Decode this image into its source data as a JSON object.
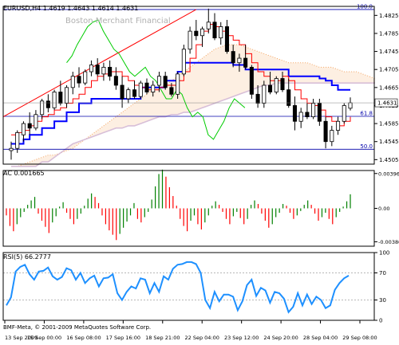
{
  "chart_data": [
    {
      "type": "candlestick",
      "title": "EURUSD,H4  1.4619 1.4643 1.4614 1.4631",
      "watermark": "Boston Merchant Financial",
      "yticks": [
        "1.4825",
        "1.4785",
        "1.4745",
        "1.4705",
        "1.4665",
        "1.4625",
        "1.4585",
        "1.4545",
        "1.4505"
      ],
      "ylim": [
        1.4495,
        1.4845
      ],
      "price_label": "1.4631",
      "fib_levels": [
        {
          "label": "100.0",
          "value": 1.4838
        },
        {
          "label": "61.8",
          "value": 1.4601
        },
        {
          "label": "50.0",
          "value": 1.4528
        }
      ],
      "colors": {
        "bull": "#008000",
        "bear": "#000000",
        "tenkan": "#ff0000",
        "kijun": "#0000ff",
        "senkou_a": "#f4a460",
        "senkou_b": "#d8bfd8",
        "chikou": "#00cc00",
        "trendline": "#ff0000"
      },
      "candles": [
        [
          1.4525,
          1.4545,
          1.4505,
          1.453
        ],
        [
          1.453,
          1.457,
          1.452,
          1.4565
        ],
        [
          1.456,
          1.459,
          1.4545,
          1.4585
        ],
        [
          1.4585,
          1.461,
          1.456,
          1.4575
        ],
        [
          1.4575,
          1.4615,
          1.457,
          1.4605
        ],
        [
          1.4605,
          1.464,
          1.4595,
          1.4635
        ],
        [
          1.4635,
          1.465,
          1.461,
          1.462
        ],
        [
          1.462,
          1.466,
          1.4615,
          1.4655
        ],
        [
          1.4655,
          1.468,
          1.4625,
          1.463
        ],
        [
          1.463,
          1.467,
          1.462,
          1.4665
        ],
        [
          1.4665,
          1.47,
          1.465,
          1.469
        ],
        [
          1.469,
          1.471,
          1.4665,
          1.4675
        ],
        [
          1.4675,
          1.4705,
          1.467,
          1.47
        ],
        [
          1.47,
          1.4725,
          1.469,
          1.4715
        ],
        [
          1.4715,
          1.473,
          1.469,
          1.4695
        ],
        [
          1.4695,
          1.472,
          1.468,
          1.471
        ],
        [
          1.471,
          1.4725,
          1.468,
          1.469
        ],
        [
          1.469,
          1.471,
          1.466,
          1.467
        ],
        [
          1.467,
          1.469,
          1.462,
          1.464
        ],
        [
          1.464,
          1.4665,
          1.463,
          1.466
        ],
        [
          1.466,
          1.468,
          1.464,
          1.4645
        ],
        [
          1.4645,
          1.468,
          1.464,
          1.4675
        ],
        [
          1.4675,
          1.4685,
          1.465,
          1.4655
        ],
        [
          1.4655,
          1.468,
          1.4645,
          1.467
        ],
        [
          1.467,
          1.47,
          1.4655,
          1.469
        ],
        [
          1.469,
          1.47,
          1.466,
          1.4665
        ],
        [
          1.4665,
          1.4675,
          1.4645,
          1.465
        ],
        [
          1.465,
          1.47,
          1.464,
          1.4695
        ],
        [
          1.4695,
          1.476,
          1.469,
          1.475
        ],
        [
          1.475,
          1.48,
          1.474,
          1.479
        ],
        [
          1.479,
          1.4815,
          1.477,
          1.478
        ],
        [
          1.478,
          1.48,
          1.4755,
          1.4795
        ],
        [
          1.4795,
          1.484,
          1.4785,
          1.481
        ],
        [
          1.481,
          1.483,
          1.477,
          1.4775
        ],
        [
          1.4775,
          1.481,
          1.476,
          1.48
        ],
        [
          1.48,
          1.4815,
          1.474,
          1.4745
        ],
        [
          1.4745,
          1.476,
          1.471,
          1.472
        ],
        [
          1.472,
          1.474,
          1.47,
          1.473
        ],
        [
          1.473,
          1.476,
          1.4705,
          1.471
        ],
        [
          1.471,
          1.4715,
          1.464,
          1.465
        ],
        [
          1.465,
          1.467,
          1.462,
          1.463
        ],
        [
          1.463,
          1.468,
          1.462,
          1.467
        ],
        [
          1.467,
          1.47,
          1.465,
          1.4655
        ],
        [
          1.4655,
          1.469,
          1.465,
          1.4685
        ],
        [
          1.4685,
          1.47,
          1.4655,
          1.466
        ],
        [
          1.466,
          1.4685,
          1.462,
          1.4625
        ],
        [
          1.4625,
          1.4645,
          1.457,
          1.459
        ],
        [
          1.459,
          1.462,
          1.4575,
          1.461
        ],
        [
          1.461,
          1.463,
          1.4595,
          1.46
        ],
        [
          1.46,
          1.464,
          1.4595,
          1.463
        ],
        [
          1.463,
          1.464,
          1.458,
          1.459
        ],
        [
          1.459,
          1.46,
          1.453,
          1.4545
        ],
        [
          1.4545,
          1.458,
          1.4535,
          1.457
        ],
        [
          1.457,
          1.46,
          1.456,
          1.459
        ],
        [
          1.459,
          1.463,
          1.4585,
          1.4625
        ],
        [
          1.4619,
          1.4643,
          1.4614,
          1.4631
        ]
      ],
      "tenkan": [
        1.456,
        1.4565,
        1.457,
        1.458,
        1.459,
        1.46,
        1.4605,
        1.4615,
        1.462,
        1.463,
        1.464,
        1.465,
        1.4665,
        1.468,
        1.469,
        1.4695,
        1.47,
        1.47,
        1.469,
        1.468,
        1.467,
        1.4665,
        1.466,
        1.466,
        1.4665,
        1.467,
        1.467,
        1.468,
        1.47,
        1.473,
        1.476,
        1.479,
        1.4805,
        1.48,
        1.479,
        1.478,
        1.477,
        1.476,
        1.474,
        1.472,
        1.47,
        1.469,
        1.468,
        1.468,
        1.469,
        1.468,
        1.466,
        1.464,
        1.463,
        1.4625,
        1.4615,
        1.46,
        1.459,
        1.458,
        1.459,
        1.46
      ],
      "kijun": [
        1.454,
        1.454,
        1.455,
        1.456,
        1.456,
        1.4575,
        1.4575,
        1.459,
        1.459,
        1.461,
        1.461,
        1.463,
        1.463,
        1.464,
        1.464,
        1.464,
        1.464,
        1.464,
        1.464,
        1.464,
        1.464,
        1.4665,
        1.4665,
        1.4665,
        1.4665,
        1.468,
        1.468,
        1.47,
        1.472,
        1.472,
        1.472,
        1.472,
        1.472,
        1.472,
        1.472,
        1.472,
        1.4715,
        1.4715,
        1.4705,
        1.4705,
        1.4705,
        1.4705,
        1.4705,
        1.4705,
        1.4705,
        1.469,
        1.469,
        1.469,
        1.469,
        1.469,
        1.4685,
        1.468,
        1.467,
        1.466,
        1.466,
        1.466
      ],
      "senkou_a": [
        1.449,
        1.449,
        1.4495,
        1.45,
        1.4505,
        1.451,
        1.4515,
        1.4515,
        1.452,
        1.4525,
        1.453,
        1.454,
        1.455,
        1.456,
        1.457,
        1.458,
        1.459,
        1.46,
        1.461,
        1.462,
        1.463,
        1.464,
        1.465,
        1.466,
        1.4665,
        1.467,
        1.468,
        1.469,
        1.47,
        1.471,
        1.472,
        1.473,
        1.474,
        1.475,
        1.4755,
        1.476,
        1.476,
        1.476,
        1.4755,
        1.475,
        1.4745,
        1.474,
        1.4735,
        1.473,
        1.4725,
        1.472,
        1.472,
        1.472,
        1.472,
        1.4715,
        1.471,
        1.471,
        1.471,
        1.4705,
        1.47,
        1.47,
        1.47,
        1.4695,
        1.469,
        1.4685
      ],
      "senkou_b": [
        1.449,
        1.449,
        1.449,
        1.449,
        1.449,
        1.45,
        1.45,
        1.451,
        1.452,
        1.453,
        1.454,
        1.4545,
        1.455,
        1.4555,
        1.456,
        1.4565,
        1.457,
        1.4575,
        1.4575,
        1.458,
        1.458,
        1.4585,
        1.459,
        1.4595,
        1.46,
        1.46,
        1.4605,
        1.4605,
        1.461,
        1.461,
        1.4615,
        1.462,
        1.4625,
        1.463,
        1.4635,
        1.464,
        1.4645,
        1.465,
        1.4655,
        1.466,
        1.4665,
        1.467,
        1.467,
        1.4675,
        1.4675,
        1.4675,
        1.4675,
        1.4675,
        1.4675,
        1.4675,
        1.4675,
        1.4675,
        1.4675,
        1.4675,
        1.4675,
        1.4675,
        1.4675,
        1.4675,
        1.4675,
        1.4675
      ],
      "chikou": [
        1.472,
        1.4735,
        1.476,
        1.478,
        1.48,
        1.481,
        1.4815,
        1.479,
        1.477,
        1.475,
        1.474,
        1.472,
        1.47,
        1.469,
        1.47,
        1.471,
        1.469,
        1.468,
        1.466,
        1.464,
        1.464,
        1.466,
        1.465,
        1.462,
        1.46,
        1.461,
        1.46,
        1.456,
        1.455,
        1.457,
        1.459,
        1.462,
        1.464,
        1.463,
        1.462
      ]
    },
    {
      "type": "bar",
      "title": "AC 0.001665",
      "yticks": [
        "0.00396",
        "0.00",
        "-0.00380"
      ],
      "ylim": [
        -0.0043,
        0.0043
      ],
      "colors": {
        "up": "#008000",
        "down": "#ff0000"
      },
      "values": [
        -0.0008,
        -0.002,
        -0.0026,
        -0.0018,
        -0.001,
        -0.0004,
        0.0004,
        0.0009,
        0.0013,
        -0.0006,
        -0.0014,
        -0.0021,
        -0.0028,
        -0.0016,
        -0.0009,
        0.0002,
        0.0007,
        -0.0005,
        -0.0012,
        -0.0018,
        -0.0012,
        -0.0006,
        0.0003,
        0.0011,
        0.0017,
        0.0013,
        0.0006,
        -0.0008,
        -0.0018,
        -0.0025,
        -0.003,
        -0.0036,
        -0.0029,
        -0.0022,
        -0.0015,
        -0.0008,
        0.0006,
        -0.0012,
        -0.0016,
        -0.001,
        -0.0004,
        0.001,
        0.0025,
        0.0039,
        0.0044,
        0.0036,
        0.0024,
        0.0014,
        0.0003,
        -0.0012,
        -0.002,
        -0.0026,
        -0.0014,
        -0.0008,
        -0.0018,
        -0.0024,
        -0.0016,
        -0.0008,
        0.0003,
        0.0008,
        0.0004,
        -0.0004,
        -0.0012,
        -0.0018,
        -0.0009,
        -0.0004,
        -0.0011,
        -0.0018,
        -0.0012,
        0.0004,
        0.0009,
        0.0005,
        -0.0006,
        -0.0014,
        -0.0022,
        -0.0018,
        -0.001,
        -0.0005,
        0.0005,
        0.0003,
        -0.0005,
        -0.0012,
        -0.0008,
        -0.0003,
        0.0004,
        0.0009,
        0.0004,
        -0.0006,
        -0.0014,
        -0.001,
        -0.0005,
        -0.0012,
        -0.0018,
        -0.001,
        -0.0004,
        0.0002,
        0.0008,
        0.0016
      ]
    },
    {
      "type": "line",
      "title": "RSI(5) 66.2777",
      "yticks": [
        "100",
        "70",
        "30",
        "0"
      ],
      "ylim": [
        0,
        100
      ],
      "levels": [
        70,
        30
      ],
      "colors": {
        "line": "#1e90ff",
        "level": "#a0a0a0"
      },
      "values": [
        22,
        34,
        72,
        79,
        82,
        68,
        60,
        72,
        73,
        78,
        65,
        60,
        64,
        77,
        74,
        60,
        70,
        55,
        62,
        66,
        50,
        62,
        63,
        68,
        40,
        30,
        42,
        50,
        47,
        62,
        60,
        40,
        55,
        42,
        65,
        60,
        76,
        82,
        83,
        86,
        86,
        83,
        70,
        30,
        18,
        42,
        28,
        38,
        38,
        35,
        15,
        28,
        52,
        60,
        36,
        48,
        44,
        26,
        42,
        40,
        32,
        12,
        20,
        40,
        22,
        38,
        24,
        35,
        30,
        18,
        22,
        45,
        55,
        62,
        66
      ],
      "footer": "BMF-Meta, © 2001-2009 MetaQuotes Software Corp."
    }
  ],
  "xticks": [
    "13 Sep 2009",
    "15 Sep 00:00",
    "16 Sep 08:00",
    "17 Sep 16:00",
    "18 Sep 21:00",
    "22 Sep 04:00",
    "23 Sep 12:00",
    "24 Sep 20:00",
    "28 Sep 04:00",
    "29 Sep 08:00"
  ]
}
